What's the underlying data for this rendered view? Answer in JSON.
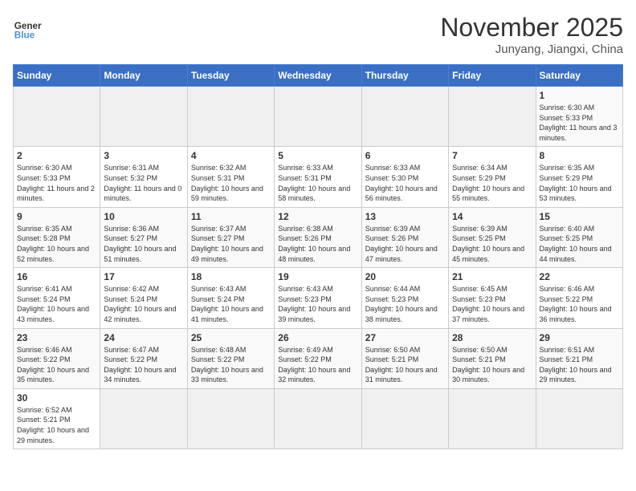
{
  "header": {
    "logo_general": "General",
    "logo_blue": "Blue",
    "month_title": "November 2025",
    "location": "Junyang, Jiangxi, China"
  },
  "weekdays": [
    "Sunday",
    "Monday",
    "Tuesday",
    "Wednesday",
    "Thursday",
    "Friday",
    "Saturday"
  ],
  "weeks": [
    [
      {
        "day": "",
        "info": ""
      },
      {
        "day": "",
        "info": ""
      },
      {
        "day": "",
        "info": ""
      },
      {
        "day": "",
        "info": ""
      },
      {
        "day": "",
        "info": ""
      },
      {
        "day": "",
        "info": ""
      },
      {
        "day": "1",
        "info": "Sunrise: 6:30 AM\nSunset: 5:33 PM\nDaylight: 11 hours and 3 minutes."
      }
    ],
    [
      {
        "day": "2",
        "info": "Sunrise: 6:30 AM\nSunset: 5:33 PM\nDaylight: 11 hours and 2 minutes."
      },
      {
        "day": "3",
        "info": "Sunrise: 6:31 AM\nSunset: 5:32 PM\nDaylight: 11 hours and 0 minutes."
      },
      {
        "day": "4",
        "info": "Sunrise: 6:32 AM\nSunset: 5:31 PM\nDaylight: 10 hours and 59 minutes."
      },
      {
        "day": "5",
        "info": "Sunrise: 6:33 AM\nSunset: 5:31 PM\nDaylight: 10 hours and 58 minutes."
      },
      {
        "day": "6",
        "info": "Sunrise: 6:33 AM\nSunset: 5:30 PM\nDaylight: 10 hours and 56 minutes."
      },
      {
        "day": "7",
        "info": "Sunrise: 6:34 AM\nSunset: 5:29 PM\nDaylight: 10 hours and 55 minutes."
      },
      {
        "day": "8",
        "info": "Sunrise: 6:35 AM\nSunset: 5:29 PM\nDaylight: 10 hours and 53 minutes."
      }
    ],
    [
      {
        "day": "9",
        "info": "Sunrise: 6:35 AM\nSunset: 5:28 PM\nDaylight: 10 hours and 52 minutes."
      },
      {
        "day": "10",
        "info": "Sunrise: 6:36 AM\nSunset: 5:27 PM\nDaylight: 10 hours and 51 minutes."
      },
      {
        "day": "11",
        "info": "Sunrise: 6:37 AM\nSunset: 5:27 PM\nDaylight: 10 hours and 49 minutes."
      },
      {
        "day": "12",
        "info": "Sunrise: 6:38 AM\nSunset: 5:26 PM\nDaylight: 10 hours and 48 minutes."
      },
      {
        "day": "13",
        "info": "Sunrise: 6:39 AM\nSunset: 5:26 PM\nDaylight: 10 hours and 47 minutes."
      },
      {
        "day": "14",
        "info": "Sunrise: 6:39 AM\nSunset: 5:25 PM\nDaylight: 10 hours and 45 minutes."
      },
      {
        "day": "15",
        "info": "Sunrise: 6:40 AM\nSunset: 5:25 PM\nDaylight: 10 hours and 44 minutes."
      }
    ],
    [
      {
        "day": "16",
        "info": "Sunrise: 6:41 AM\nSunset: 5:24 PM\nDaylight: 10 hours and 43 minutes."
      },
      {
        "day": "17",
        "info": "Sunrise: 6:42 AM\nSunset: 5:24 PM\nDaylight: 10 hours and 42 minutes."
      },
      {
        "day": "18",
        "info": "Sunrise: 6:43 AM\nSunset: 5:24 PM\nDaylight: 10 hours and 41 minutes."
      },
      {
        "day": "19",
        "info": "Sunrise: 6:43 AM\nSunset: 5:23 PM\nDaylight: 10 hours and 39 minutes."
      },
      {
        "day": "20",
        "info": "Sunrise: 6:44 AM\nSunset: 5:23 PM\nDaylight: 10 hours and 38 minutes."
      },
      {
        "day": "21",
        "info": "Sunrise: 6:45 AM\nSunset: 5:23 PM\nDaylight: 10 hours and 37 minutes."
      },
      {
        "day": "22",
        "info": "Sunrise: 6:46 AM\nSunset: 5:22 PM\nDaylight: 10 hours and 36 minutes."
      }
    ],
    [
      {
        "day": "23",
        "info": "Sunrise: 6:46 AM\nSunset: 5:22 PM\nDaylight: 10 hours and 35 minutes."
      },
      {
        "day": "24",
        "info": "Sunrise: 6:47 AM\nSunset: 5:22 PM\nDaylight: 10 hours and 34 minutes."
      },
      {
        "day": "25",
        "info": "Sunrise: 6:48 AM\nSunset: 5:22 PM\nDaylight: 10 hours and 33 minutes."
      },
      {
        "day": "26",
        "info": "Sunrise: 6:49 AM\nSunset: 5:22 PM\nDaylight: 10 hours and 32 minutes."
      },
      {
        "day": "27",
        "info": "Sunrise: 6:50 AM\nSunset: 5:21 PM\nDaylight: 10 hours and 31 minutes."
      },
      {
        "day": "28",
        "info": "Sunrise: 6:50 AM\nSunset: 5:21 PM\nDaylight: 10 hours and 30 minutes."
      },
      {
        "day": "29",
        "info": "Sunrise: 6:51 AM\nSunset: 5:21 PM\nDaylight: 10 hours and 29 minutes."
      }
    ],
    [
      {
        "day": "30",
        "info": "Sunrise: 6:52 AM\nSunset: 5:21 PM\nDaylight: 10 hours and 29 minutes."
      },
      {
        "day": "",
        "info": ""
      },
      {
        "day": "",
        "info": ""
      },
      {
        "day": "",
        "info": ""
      },
      {
        "day": "",
        "info": ""
      },
      {
        "day": "",
        "info": ""
      },
      {
        "day": "",
        "info": ""
      }
    ]
  ]
}
